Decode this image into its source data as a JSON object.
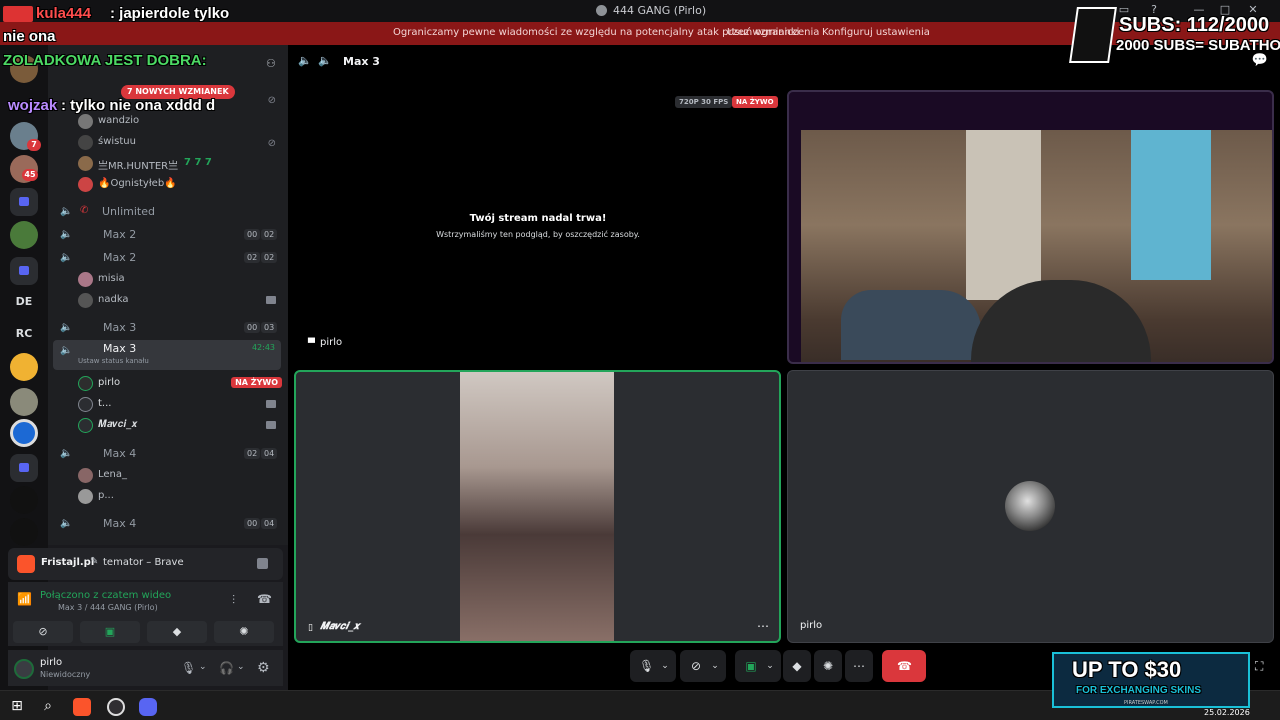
{
  "window": {
    "title": "444 GANG (Pirlo)"
  },
  "notice": {
    "text": "Ograniczamy pewne wiadomości ze względu na potencjalny atak przez wzmianki",
    "action1": "Usuń ograniczenia",
    "action2": "Konfiguruj ustawienia"
  },
  "rail": {
    "server_badge_1": "7",
    "server_badge_2": "45",
    "text_server_de": "DE",
    "text_server_rc": "RC"
  },
  "sidebar": {
    "new_mentions": "7 NOWYCH WZMIANEK",
    "rows": [
      {
        "name": "Unlimited"
      },
      {
        "name": "Max 2",
        "c1": "00",
        "c2": "02"
      },
      {
        "name": "Max 2",
        "c1": "02",
        "c2": "02"
      },
      {
        "name": "Max 3",
        "c1": "00",
        "c2": "03"
      },
      {
        "name": "Max 3",
        "time": "42:43",
        "status": "Ustaw status kanału"
      },
      {
        "name": "Max 4",
        "c1": "02",
        "c2": "04"
      },
      {
        "name": "Max 4",
        "c1": "00",
        "c2": "04"
      }
    ],
    "users_top": [
      "wandzio",
      "świstuu",
      "亗MR.HUNTER亗",
      "🔥Ognistyłeb🔥"
    ],
    "hunter_tag": "7 7 7",
    "users_max2": [
      "misia",
      "nadka"
    ],
    "users_max3": [
      "pirlo",
      "t...",
      "𝑴𝒂𝒗𝒄𝒊_𝒙"
    ],
    "live_badge": "NA ŻYWO",
    "users_max4": [
      "Lena_",
      "p..."
    ]
  },
  "activity": {
    "app": "Fristajl.pl",
    "detail": "temator – Brave"
  },
  "voice": {
    "status": "Połączono z czatem wideo",
    "channel": "Max 3 / 444 GANG (Pirlo)"
  },
  "user": {
    "name": "pirlo",
    "status": "Niewidoczny"
  },
  "main": {
    "channel": "Max 3",
    "quality": "720P 30 FPS",
    "live": "NA ŻYWO",
    "stream_title": "Twój stream nadal trwa!",
    "stream_sub": "Wstrzymaliśmy ten podgląd, by oszczędzić zasoby.",
    "stream_owner": "pirlo",
    "tile2_name": "𝑴𝒂𝒗𝒄𝒊_𝒙",
    "tile3_name": "pirlo"
  },
  "overlay": {
    "chat1_user": "kula444",
    "chat1_text": ": japierdole tylko",
    "chat1_cont": "nie ona",
    "chat2": "ZOLADKOWA JEST DOBRA:",
    "chat3_user": "wojzak",
    "chat3_text": ": tylko nie ona xddd d",
    "subs": "SUBS: 112/2000",
    "subathon": "2000 SUBS= SUBATHON",
    "ad_big": "UP TO $30",
    "ad_small": "FOR EXCHANGING SKINS",
    "ad_domain": "PIRATESWAP.COM",
    "date": "25.02.2026"
  },
  "colors": {
    "accent_green": "#23a55a",
    "live_red": "#da373c",
    "notice_red": "#8a1717",
    "hangup": "#da373c",
    "ad_blue": "#1ac0d8"
  }
}
